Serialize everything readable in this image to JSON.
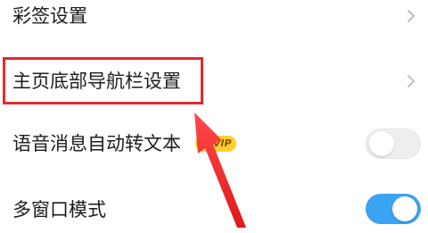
{
  "settings": {
    "items": [
      {
        "label": "彩签设置",
        "control": "chevron"
      },
      {
        "label": "主页底部导航栏设置",
        "control": "chevron",
        "highlighted": true
      },
      {
        "label": "语音消息自动转文本",
        "control": "toggle",
        "toggle_state": "off",
        "badge": "SVIP"
      },
      {
        "label": "多窗口模式",
        "control": "toggle",
        "toggle_state": "on"
      }
    ]
  },
  "icons": {
    "chevron": "chevron-right-icon",
    "annotation": "red-arrow-icon"
  },
  "colors": {
    "highlight": "#e02a2f",
    "toggle_on": "#3aa3f2",
    "toggle_off": "#eeeeee",
    "badge": "#ffcf33"
  }
}
